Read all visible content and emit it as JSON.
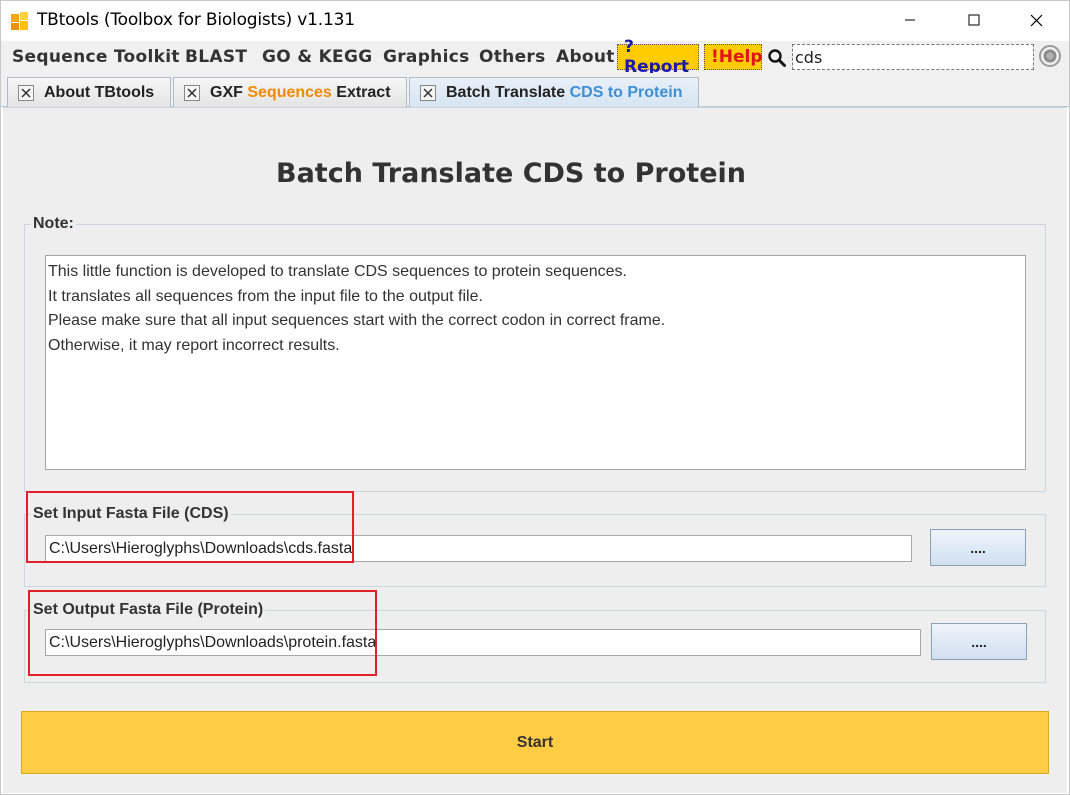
{
  "window": {
    "title": "TBtools (Toolbox for Biologists) v1.131"
  },
  "menu": {
    "items": [
      "Sequence Toolkit",
      "BLAST",
      "GO & KEGG",
      "Graphics",
      "Others",
      "About"
    ],
    "report_label": "?Report",
    "help_label": "!Help",
    "search_value": "cds"
  },
  "tabs": [
    {
      "plain_before": "About TBtools",
      "highlight": "",
      "plain_after": ""
    },
    {
      "plain_before": "GXF ",
      "highlight": "Sequences",
      "plain_after": " Extract"
    },
    {
      "plain_before": "Batch Translate ",
      "highlight": "CDS to Protein",
      "plain_after": ""
    }
  ],
  "colors": {
    "accent_yellow": "#ffcc00",
    "start_button": "#ffcc44",
    "highlight_orange": "#f08a00",
    "highlight_blue": "#3d8fd6",
    "annotation_red": "#e0202a"
  },
  "main": {
    "heading": "Batch Translate CDS to Protein",
    "note_title": "Note:",
    "note_lines": [
      "This little function is developed to translate CDS sequences to protein sequences.",
      "It translates all sequences from the input file to the output file.",
      "Please make sure that all input sequences start with the correct codon in correct frame.",
      "Otherwise, it may report incorrect results."
    ],
    "input_title": "Set Input Fasta File (CDS)",
    "input_path": "C:\\Users\\Hieroglyphs\\Downloads\\cds.fasta",
    "output_title": "Set Output Fasta File (Protein)",
    "output_path": "C:\\Users\\Hieroglyphs\\Downloads\\protein.fasta",
    "browse_label": "....",
    "start_label": "Start"
  }
}
